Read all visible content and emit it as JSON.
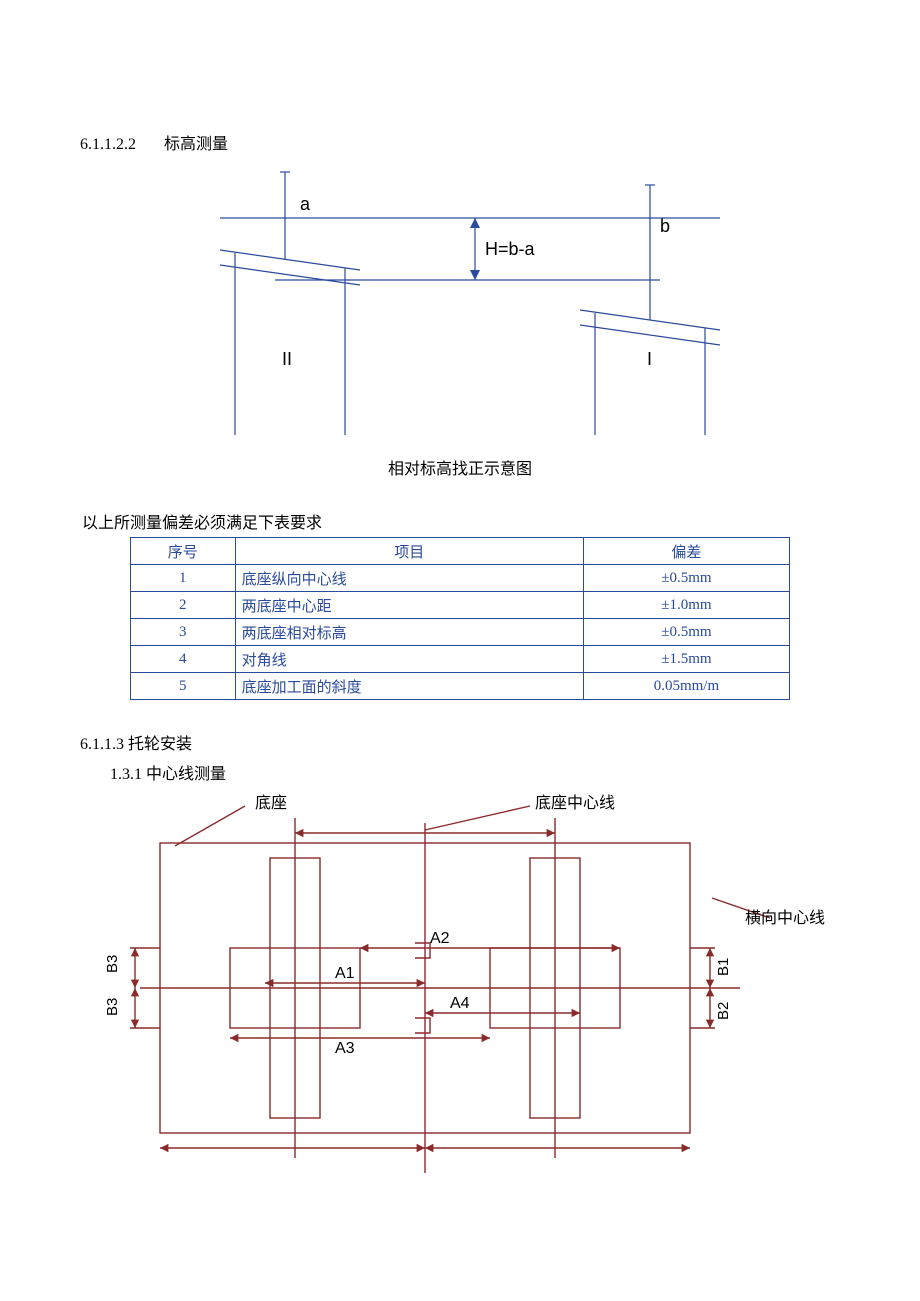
{
  "section1": {
    "number": "6.1.1.2.2",
    "title": "标高测量"
  },
  "figure1": {
    "label_a": "a",
    "label_b": "b",
    "formula": "H=b-a",
    "label_I": "I",
    "label_II": "II",
    "caption": "相对标高找正示意图"
  },
  "table_note": "以上所测量偏差必须满足下表要求",
  "table_headers": {
    "col1": "序号",
    "col2": "项目",
    "col3": "偏差"
  },
  "rows": [
    {
      "idx": "1",
      "item": "底座纵向中心线",
      "dev": "±0.5mm"
    },
    {
      "idx": "2",
      "item": "两底座中心距",
      "dev": "±1.0mm"
    },
    {
      "idx": "3",
      "item": "两底座相对标高",
      "dev": "±0.5mm"
    },
    {
      "idx": "4",
      "item": "对角线",
      "dev": "±1.5mm"
    },
    {
      "idx": "5",
      "item": "底座加工面的斜度",
      "dev": "0.05mm/m"
    }
  ],
  "section2": {
    "number_title": "6.1.1.3 托轮安装",
    "sub": "1.3.1  中心线测量"
  },
  "figure2": {
    "lbl_base": "底座",
    "lbl_base_center": "底座中心线",
    "lbl_horiz_center": "横向中心线",
    "A1": "A1",
    "A2": "A2",
    "A3": "A3",
    "A4": "A4",
    "B1": "B1",
    "B2": "B2",
    "B3": "B3"
  }
}
